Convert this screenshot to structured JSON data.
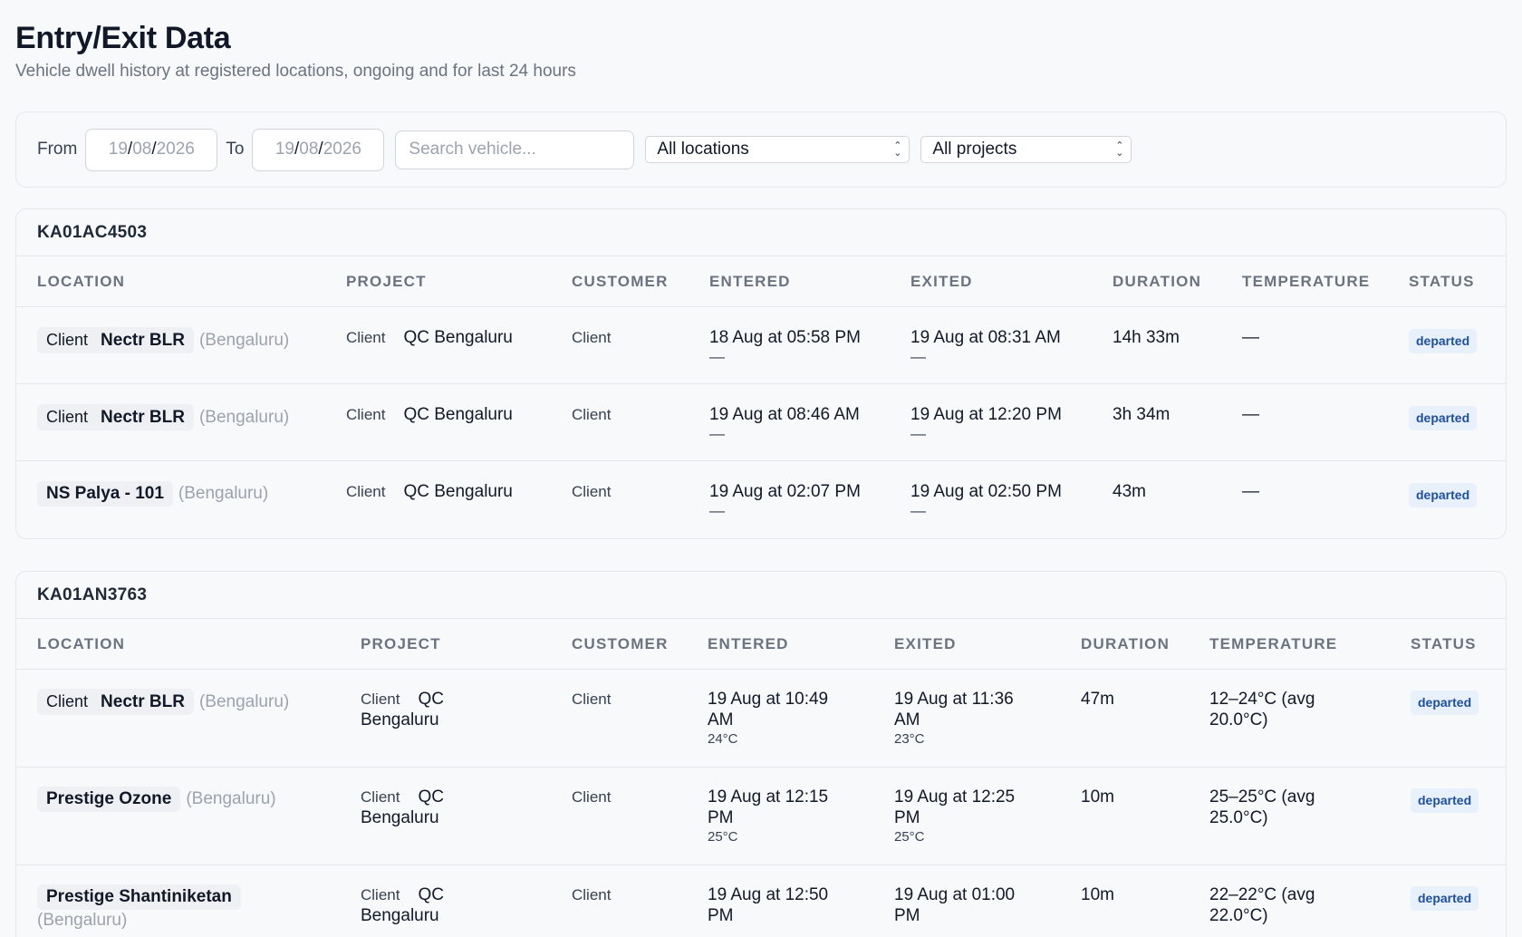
{
  "header": {
    "title": "Entry/Exit Data",
    "subtitle": "Vehicle dwell history at registered locations, ongoing and for last 24 hours"
  },
  "filters": {
    "from_label": "From",
    "to_label": "To",
    "from_date": {
      "dd": "19",
      "mm": "08",
      "yyyy": "2026"
    },
    "to_date": {
      "dd": "19",
      "mm": "08",
      "yyyy": "2026"
    },
    "search_placeholder": "Search vehicle...",
    "location_select": "All locations",
    "project_select": "All projects"
  },
  "columns": {
    "location": "LOCATION",
    "project": "PROJECT",
    "customer": "CUSTOMER",
    "entered": "ENTERED",
    "exited": "EXITED",
    "duration": "DURATION",
    "temperature": "TEMPERATURE",
    "status": "STATUS"
  },
  "groups": [
    {
      "vehicle": "KA01AC4503",
      "rows": [
        {
          "loc_prefix": "Client",
          "loc_name": "Nectr BLR",
          "city": "(Bengaluru)",
          "proj_prefix": "Client",
          "project": "QC Bengaluru",
          "customer": "Client",
          "entered": "18 Aug at 05:58 PM",
          "entered_sub": "—",
          "exited": "19 Aug at 08:31 AM",
          "exited_sub": "—",
          "duration": "14h 33m",
          "temperature": "—",
          "status": "departed"
        },
        {
          "loc_prefix": "Client",
          "loc_name": "Nectr BLR",
          "city": "(Bengaluru)",
          "proj_prefix": "Client",
          "project": "QC Bengaluru",
          "customer": "Client",
          "entered": "19 Aug at 08:46 AM",
          "entered_sub": "—",
          "exited": "19 Aug at 12:20 PM",
          "exited_sub": "—",
          "duration": "3h 34m",
          "temperature": "—",
          "status": "departed"
        },
        {
          "loc_prefix": "",
          "loc_name": "NS Palya - 101",
          "city": "(Bengaluru)",
          "proj_prefix": "Client",
          "project": "QC Bengaluru",
          "customer": "Client",
          "entered": "19 Aug at 02:07 PM",
          "entered_sub": "—",
          "exited": "19 Aug at 02:50 PM",
          "exited_sub": "—",
          "duration": "43m",
          "temperature": "—",
          "status": "departed"
        }
      ]
    },
    {
      "vehicle": "KA01AN3763",
      "rows": [
        {
          "loc_prefix": "Client",
          "loc_name": "Nectr BLR",
          "city": "(Bengaluru)",
          "proj_prefix": "Client",
          "project_a": "QC",
          "project_b": "Bengaluru",
          "customer": "Client",
          "entered_a": "19 Aug at 10:49",
          "entered_b": "AM",
          "entered_temp": "24°C",
          "exited_a": "19 Aug at 11:36",
          "exited_b": "AM",
          "exited_temp": "23°C",
          "duration": "47m",
          "temp_a": "12–24°C (avg",
          "temp_b": "20.0°C)",
          "status": "departed"
        },
        {
          "loc_prefix": "",
          "loc_name": "Prestige Ozone",
          "city": "(Bengaluru)",
          "proj_prefix": "Client",
          "project_a": "QC",
          "project_b": "Bengaluru",
          "customer": "Client",
          "entered_a": "19 Aug at 12:15",
          "entered_b": "PM",
          "entered_temp": "25°C",
          "exited_a": "19 Aug at 12:25",
          "exited_b": "PM",
          "exited_temp": "25°C",
          "duration": "10m",
          "temp_a": "25–25°C (avg",
          "temp_b": "25.0°C)",
          "status": "departed"
        },
        {
          "loc_prefix": "",
          "loc_name": "Prestige Shantiniketan",
          "city": "(Bengaluru)",
          "proj_prefix": "Client",
          "project_a": "QC",
          "project_b": "Bengaluru",
          "customer": "Client",
          "entered_a": "19 Aug at 12:50",
          "entered_b": "PM",
          "entered_temp": "",
          "exited_a": "19 Aug at 01:00",
          "exited_b": "PM",
          "exited_temp": "",
          "duration": "10m",
          "temp_a": "22–22°C (avg",
          "temp_b": "22.0°C)",
          "status": "departed"
        }
      ]
    }
  ]
}
